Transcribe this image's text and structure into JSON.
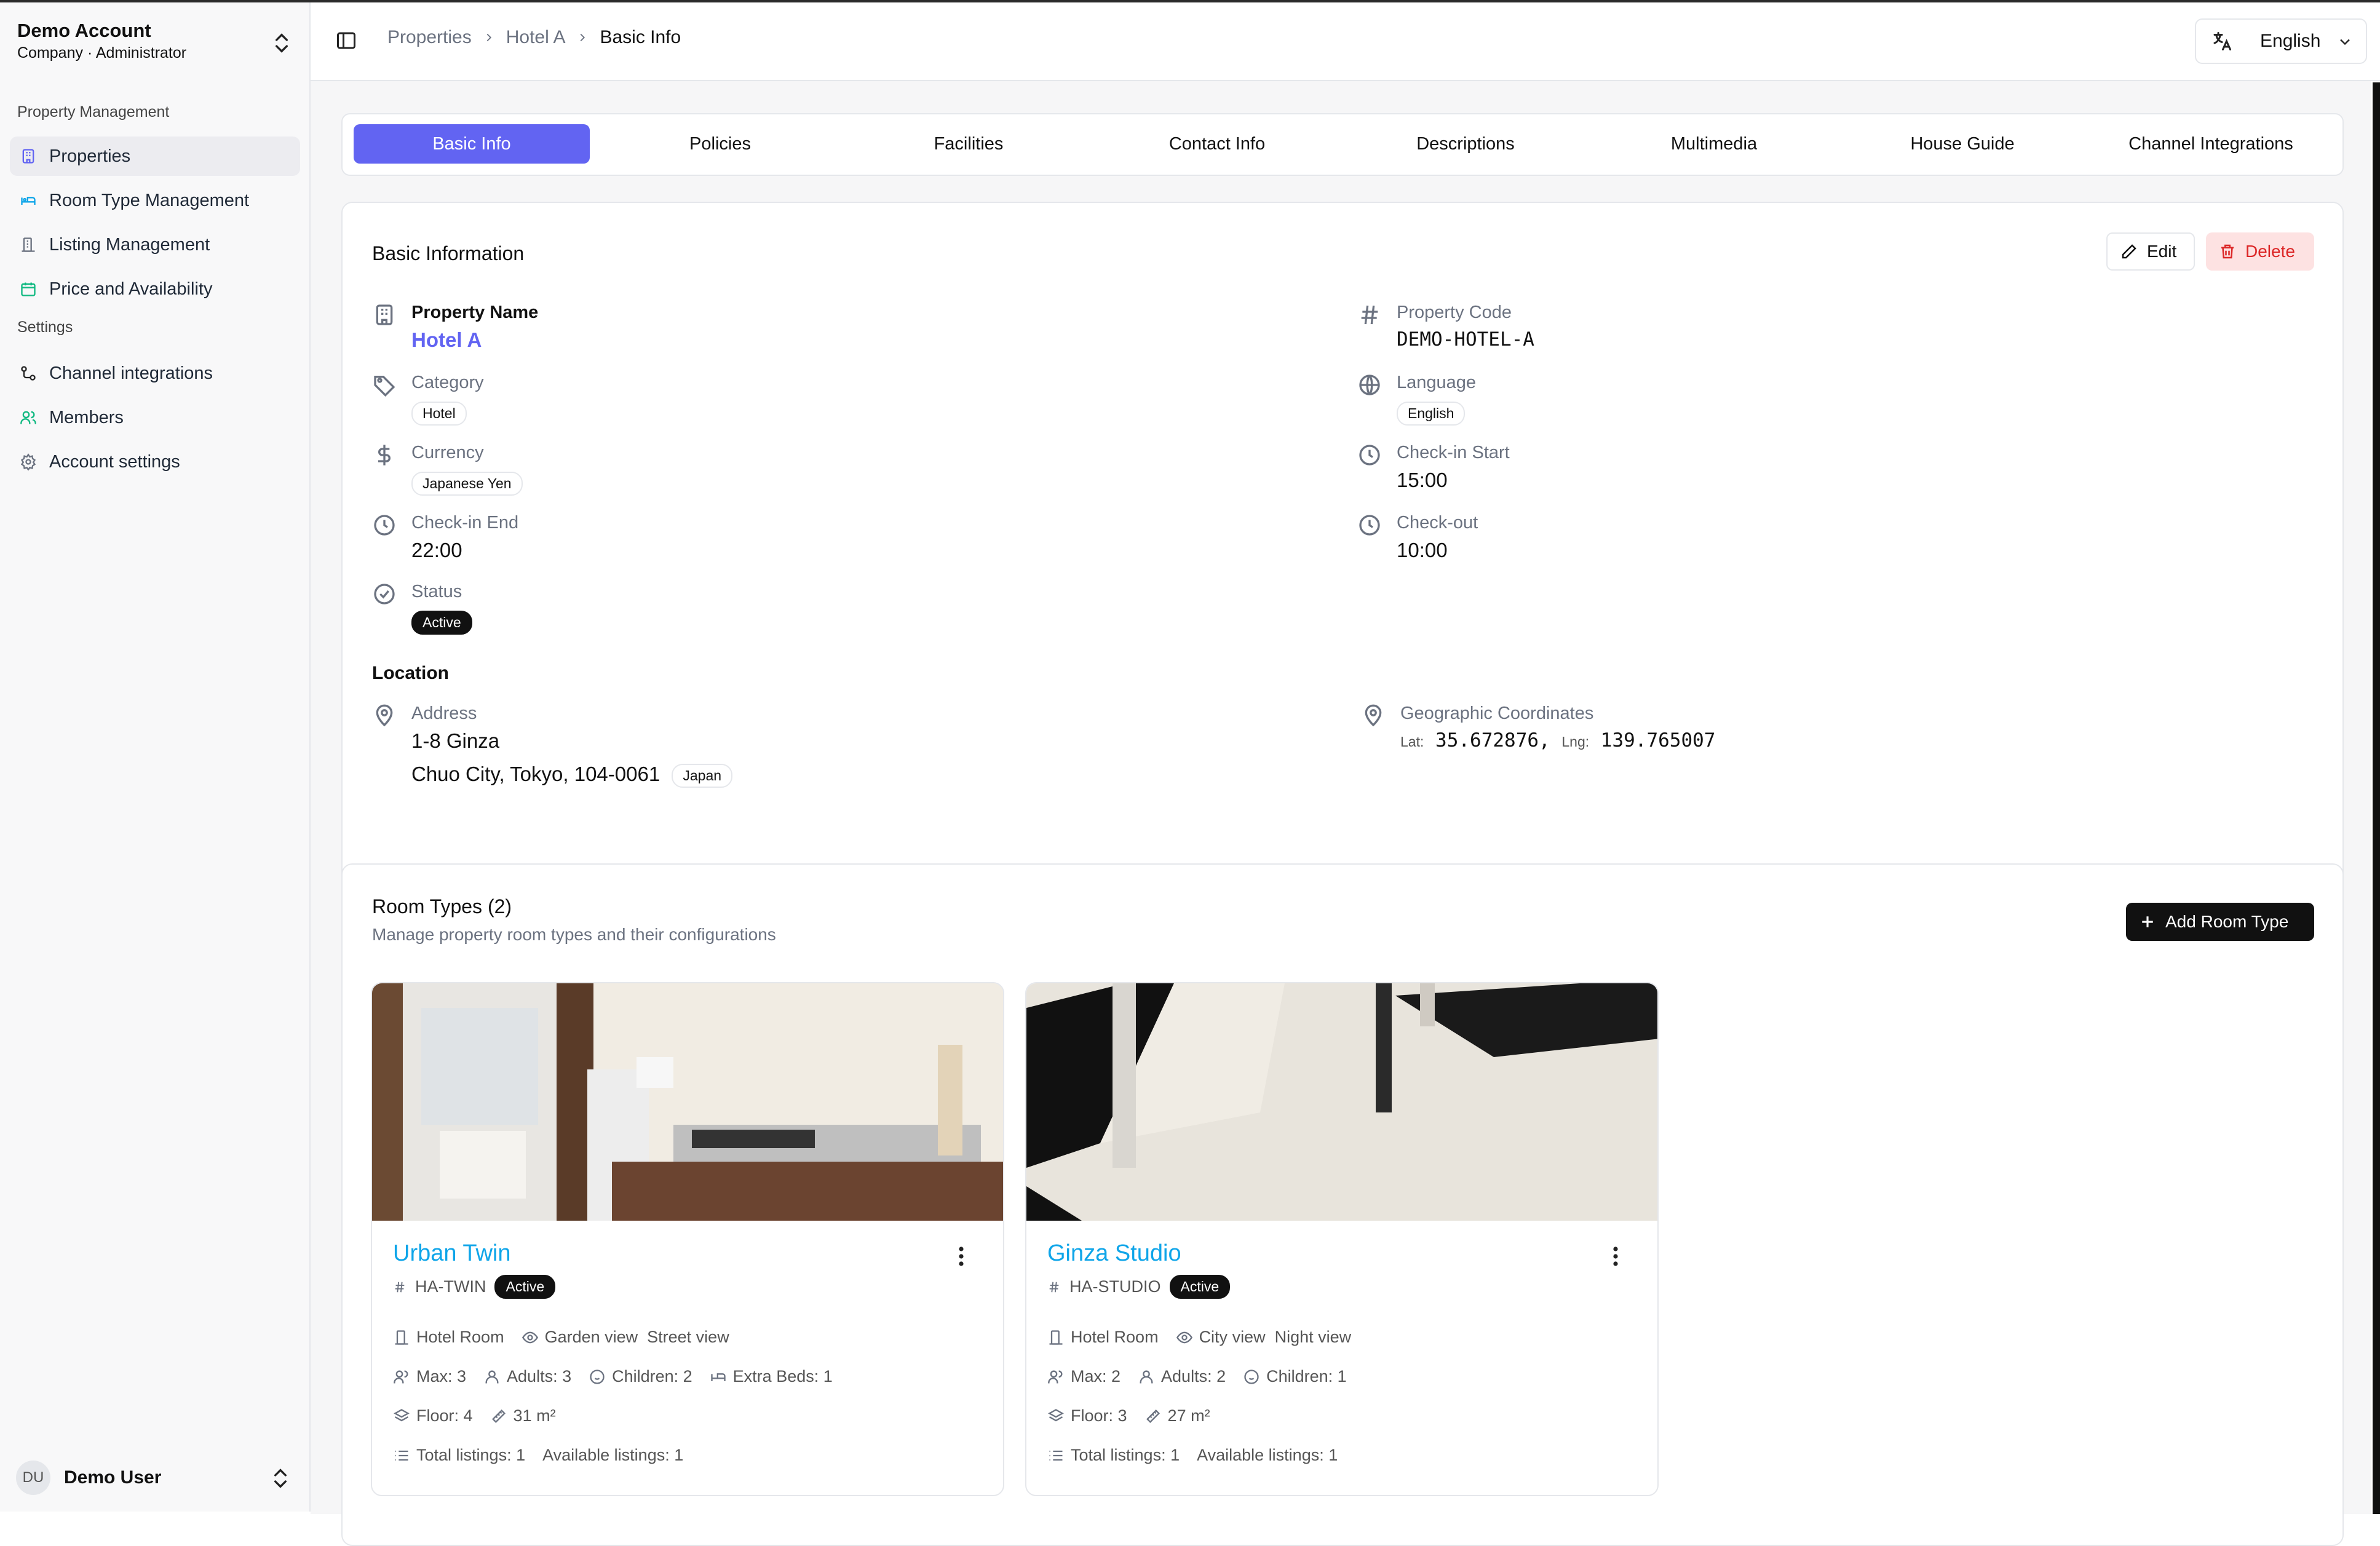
{
  "account": {
    "name": "Demo Account",
    "role": "Company · Administrator"
  },
  "sidebar": {
    "sections": [
      {
        "label": "Property Management",
        "items": [
          {
            "label": "Properties",
            "icon": "building-icon",
            "active": true
          },
          {
            "label": "Room Type Management",
            "icon": "bed-icon"
          },
          {
            "label": "Listing Management",
            "icon": "list-building-icon"
          },
          {
            "label": "Price and Availability",
            "icon": "calendar-icon"
          }
        ]
      },
      {
        "label": "Settings",
        "items": [
          {
            "label": "Channel integrations",
            "icon": "integration-icon"
          },
          {
            "label": "Members",
            "icon": "users-icon"
          },
          {
            "label": "Account settings",
            "icon": "gear-icon"
          }
        ]
      }
    ],
    "user": {
      "initials": "DU",
      "name": "Demo User"
    }
  },
  "breadcrumb": [
    "Properties",
    "Hotel A",
    "Basic Info"
  ],
  "language_selector": {
    "value": "English"
  },
  "tabs": [
    "Basic Info",
    "Policies",
    "Facilities",
    "Contact Info",
    "Descriptions",
    "Multimedia",
    "House Guide",
    "Channel Integrations"
  ],
  "basic_info": {
    "title": "Basic Information",
    "edit_label": "Edit",
    "delete_label": "Delete",
    "property_name": {
      "label": "Property Name",
      "value": "Hotel A"
    },
    "property_code": {
      "label": "Property Code",
      "value": "DEMO-HOTEL-A"
    },
    "category": {
      "label": "Category",
      "value": "Hotel"
    },
    "language": {
      "label": "Language",
      "value": "English"
    },
    "currency": {
      "label": "Currency",
      "value": "Japanese Yen"
    },
    "checkin_start": {
      "label": "Check-in Start",
      "value": "15:00"
    },
    "checkin_end": {
      "label": "Check-in End",
      "value": "22:00"
    },
    "checkout": {
      "label": "Check-out",
      "value": "10:00"
    },
    "status": {
      "label": "Status",
      "value": "Active"
    },
    "location": {
      "title": "Location",
      "address_label": "Address",
      "address_line1": "1-8 Ginza",
      "address_line2": "Chuo City, Tokyo, 104-0061",
      "country": "Japan",
      "coords_label": "Geographic Coordinates",
      "lat_label": "Lat:",
      "lat": "35.672876,",
      "lng_label": "Lng:",
      "lng": "139.765007"
    }
  },
  "room_types": {
    "title": "Room Types (2)",
    "subtitle": "Manage property room types and their configurations",
    "add_label": "Add Room Type",
    "items": [
      {
        "name": "Urban Twin",
        "code": "HA-TWIN",
        "status": "Active",
        "type": "Hotel Room",
        "views": "Garden view  Street view",
        "max": "Max: 3",
        "adults": "Adults: 3",
        "children": "Children: 2",
        "extra_beds": "Extra Beds: 1",
        "floor": "Floor: 4",
        "size": "31 m²",
        "total_listings": "Total listings: 1",
        "available_listings": "Available listings: 1"
      },
      {
        "name": "Ginza Studio",
        "code": "HA-STUDIO",
        "status": "Active",
        "type": "Hotel Room",
        "views": "City view  Night view",
        "max": "Max: 2",
        "adults": "Adults: 2",
        "children": "Children: 1",
        "floor": "Floor: 3",
        "size": "27 m²",
        "total_listings": "Total listings: 1",
        "available_listings": "Available listings: 1"
      }
    ]
  },
  "colors": {
    "accent": "#6264f2",
    "link_blue": "#0ea5e9",
    "danger": "#dc2626",
    "danger_bg": "#fde2e2"
  }
}
